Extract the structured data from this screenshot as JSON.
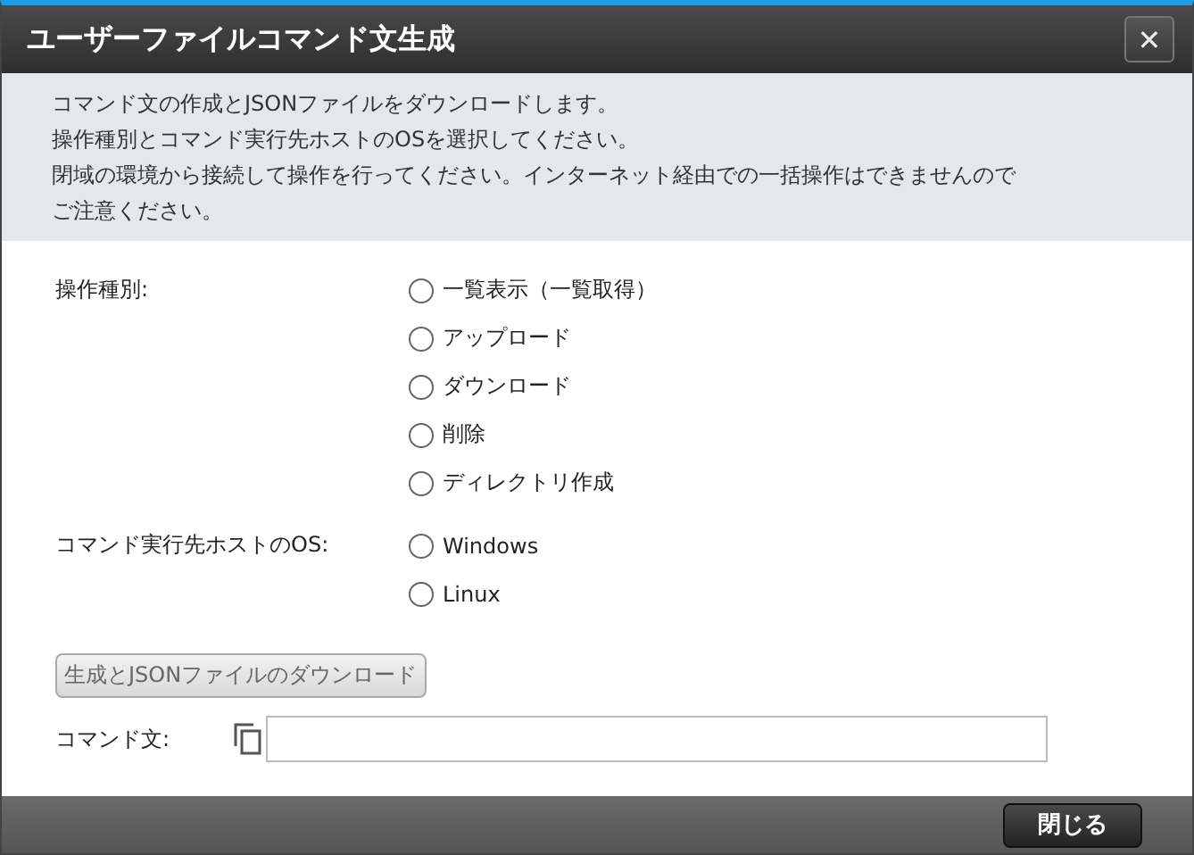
{
  "window": {
    "title": "ユーザーファイルコマンド文生成",
    "close": "✕"
  },
  "description": [
    "コマンド文の作成とJSONファイルをダウンロードします。",
    "操作種別とコマンド実行先ホストのOSを選択してください。",
    "閉域の環境から接続して操作を行ってください。インターネット経由での一括操作はできませんので",
    "ご注意ください。"
  ],
  "groups": [
    {
      "label": "操作種別:",
      "options": [
        {
          "label": "一覧表示（一覧取得）",
          "selected": false
        },
        {
          "label": "アップロード",
          "selected": false
        },
        {
          "label": "ダウンロード",
          "selected": false
        },
        {
          "label": "削除",
          "selected": false
        },
        {
          "label": "ディレクトリ作成",
          "selected": false
        }
      ]
    },
    {
      "label": "コマンド実行先ホストのOS:",
      "options": [
        {
          "label": "Windows",
          "selected": false
        },
        {
          "label": "Linux",
          "selected": false
        }
      ]
    }
  ],
  "generate_button": {
    "label": "生成とJSONファイルのダウンロード",
    "disabled": true
  },
  "command": {
    "label": "コマンド文:"
  },
  "footer": {
    "close_button": "閉じる"
  }
}
